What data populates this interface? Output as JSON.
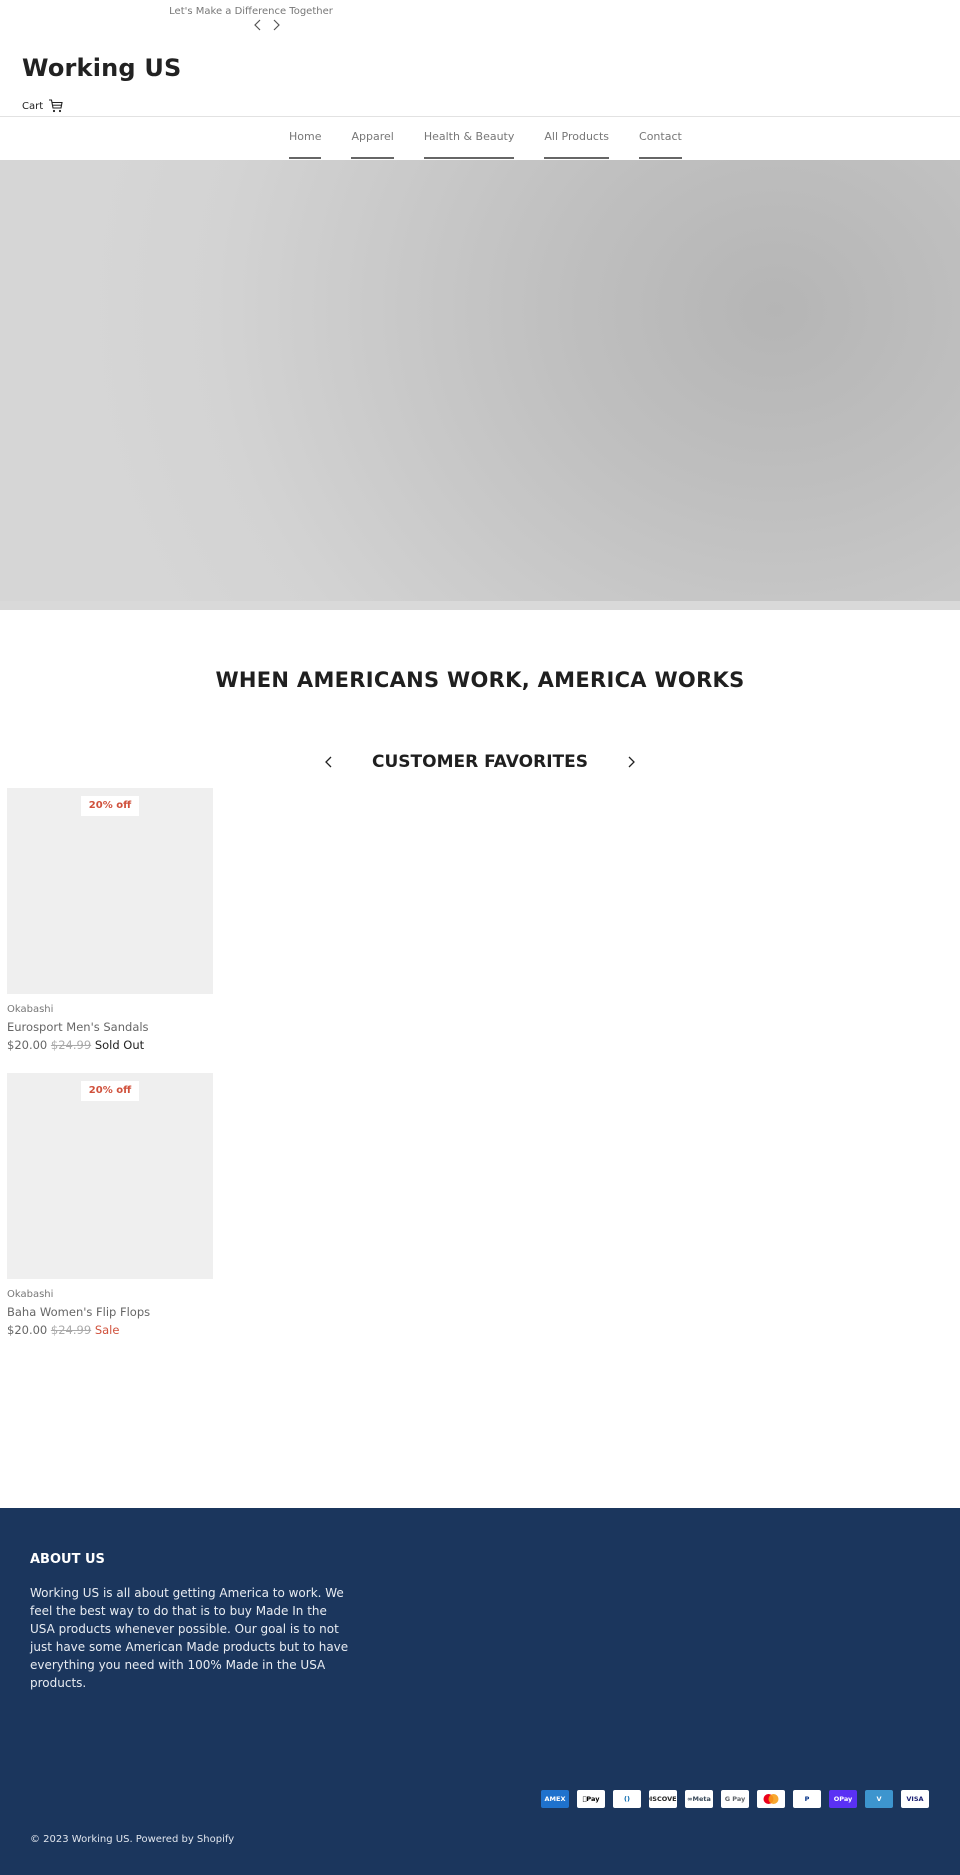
{
  "announcement": {
    "text": "Let's Make a Difference Together",
    "prev_icon": "chevron-left-icon",
    "next_icon": "chevron-right-icon"
  },
  "header": {
    "logo": "Working US",
    "cart_label": "Cart",
    "cart_icon": "cart-icon"
  },
  "nav": {
    "items": [
      {
        "label": "Home"
      },
      {
        "label": "Apparel"
      },
      {
        "label": "Health & Beauty"
      },
      {
        "label": "All Products"
      },
      {
        "label": "Contact"
      }
    ]
  },
  "tagline": "WHEN AMERICANS WORK, AMERICA WORKS",
  "favorites": {
    "title": "CUSTOMER FAVORITES",
    "products": [
      {
        "badge": "20% off",
        "vendor": "Okabashi",
        "name": "Eurosport Men's Sandals",
        "price": "$20.00",
        "compare_price": "$24.99",
        "status": "Sold Out"
      },
      {
        "badge": "20% off",
        "vendor": "Okabashi",
        "name": "Baha Women's Flip Flops",
        "price": "$20.00",
        "compare_price": "$24.99",
        "status": "Sale"
      }
    ]
  },
  "footer": {
    "about_title": "ABOUT US",
    "about_text": "Working US is all about getting America to work. We feel the best way to do that is to buy Made In the USA products whenever possible. Our goal is to not just have some American Made products but to have everything you need with 100% Made in the USA products.",
    "payment_methods": [
      {
        "name": "American Express",
        "label": "AMEX",
        "bg": "#1f72cd",
        "fg": "#ffffff"
      },
      {
        "name": "Apple Pay",
        "label": "Pay",
        "bg": "#ffffff",
        "fg": "#000000"
      },
      {
        "name": "Diners Club",
        "label": "()",
        "bg": "#ffffff",
        "fg": "#0165ac"
      },
      {
        "name": "Discover",
        "label": "DISCOVER",
        "bg": "#ffffff",
        "fg": "#222222"
      },
      {
        "name": "Meta Pay",
        "label": "∞Meta",
        "bg": "#ffffff",
        "fg": "#3a4a5a"
      },
      {
        "name": "Google Pay",
        "label": "G Pay",
        "bg": "#ffffff",
        "fg": "#5f6368"
      },
      {
        "name": "Mastercard",
        "label": "",
        "bg": "#ffffff",
        "fg": "#eb001b"
      },
      {
        "name": "PayPal",
        "label": "P",
        "bg": "#ffffff",
        "fg": "#003087"
      },
      {
        "name": "Shop Pay",
        "label": "OPay",
        "bg": "#5a31f4",
        "fg": "#ffffff"
      },
      {
        "name": "Venmo",
        "label": "V",
        "bg": "#3d95ce",
        "fg": "#ffffff"
      },
      {
        "name": "Visa",
        "label": "VISA",
        "bg": "#ffffff",
        "fg": "#1a1f71"
      }
    ],
    "copyright": "© 2023 Working US. Powered by Shopify"
  },
  "colors": {
    "footer_bg": "#1b365d",
    "sale_red": "#d0513c",
    "placeholder_gray": "#efefef"
  }
}
